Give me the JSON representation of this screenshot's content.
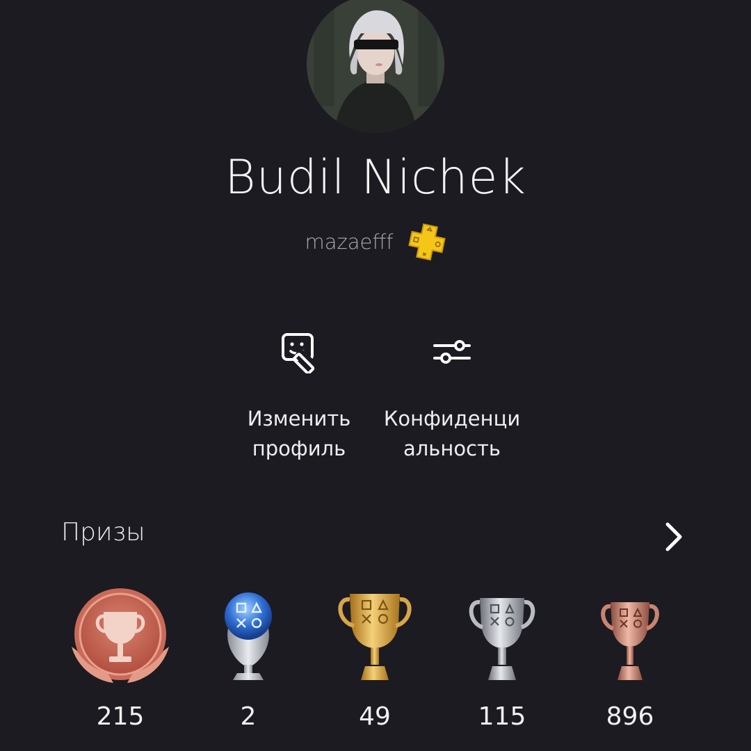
{
  "profile": {
    "display_name": "Budil Nichek",
    "online_id": "mazaefff",
    "avatar": "avatar-image",
    "membership_icon": "playstation-plus-icon"
  },
  "actions": {
    "edit_profile": {
      "label": "Изменить\nпрофиль",
      "icon": "edit-profile-icon"
    },
    "privacy": {
      "label": "Конфиденци\nальность",
      "icon": "sliders-icon"
    }
  },
  "trophies": {
    "title": "Призы",
    "chevron_icon": "chevron-right-icon",
    "items": [
      {
        "type": "level",
        "icon": "trophy-level-icon",
        "count": "215"
      },
      {
        "type": "platinum",
        "icon": "platinum-trophy-icon",
        "count": "2"
      },
      {
        "type": "gold",
        "icon": "gold-trophy-icon",
        "count": "49"
      },
      {
        "type": "silver",
        "icon": "silver-trophy-icon",
        "count": "115"
      },
      {
        "type": "bronze",
        "icon": "bronze-trophy-icon",
        "count": "896"
      }
    ]
  },
  "colors": {
    "background": "#1c1b22",
    "psplus": "#f5c518",
    "gold": "#e0a93a",
    "silver": "#b9bcc2",
    "bronze": "#c98472",
    "platinum": "#3b7fe0"
  }
}
